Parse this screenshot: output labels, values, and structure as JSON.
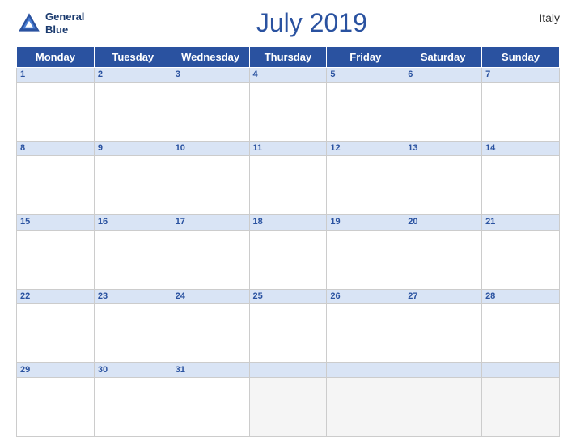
{
  "header": {
    "title": "July 2019",
    "country": "Italy",
    "logo": {
      "line1": "General",
      "line2": "Blue"
    }
  },
  "days": [
    "Monday",
    "Tuesday",
    "Wednesday",
    "Thursday",
    "Friday",
    "Saturday",
    "Sunday"
  ],
  "weeks": [
    [
      1,
      2,
      3,
      4,
      5,
      6,
      7
    ],
    [
      8,
      9,
      10,
      11,
      12,
      13,
      14
    ],
    [
      15,
      16,
      17,
      18,
      19,
      20,
      21
    ],
    [
      22,
      23,
      24,
      25,
      26,
      27,
      28
    ],
    [
      29,
      30,
      31,
      null,
      null,
      null,
      null
    ]
  ],
  "colors": {
    "header_bg": "#2a52a0",
    "row_stripe": "#d9e4f5",
    "text_blue": "#2a52a0"
  }
}
